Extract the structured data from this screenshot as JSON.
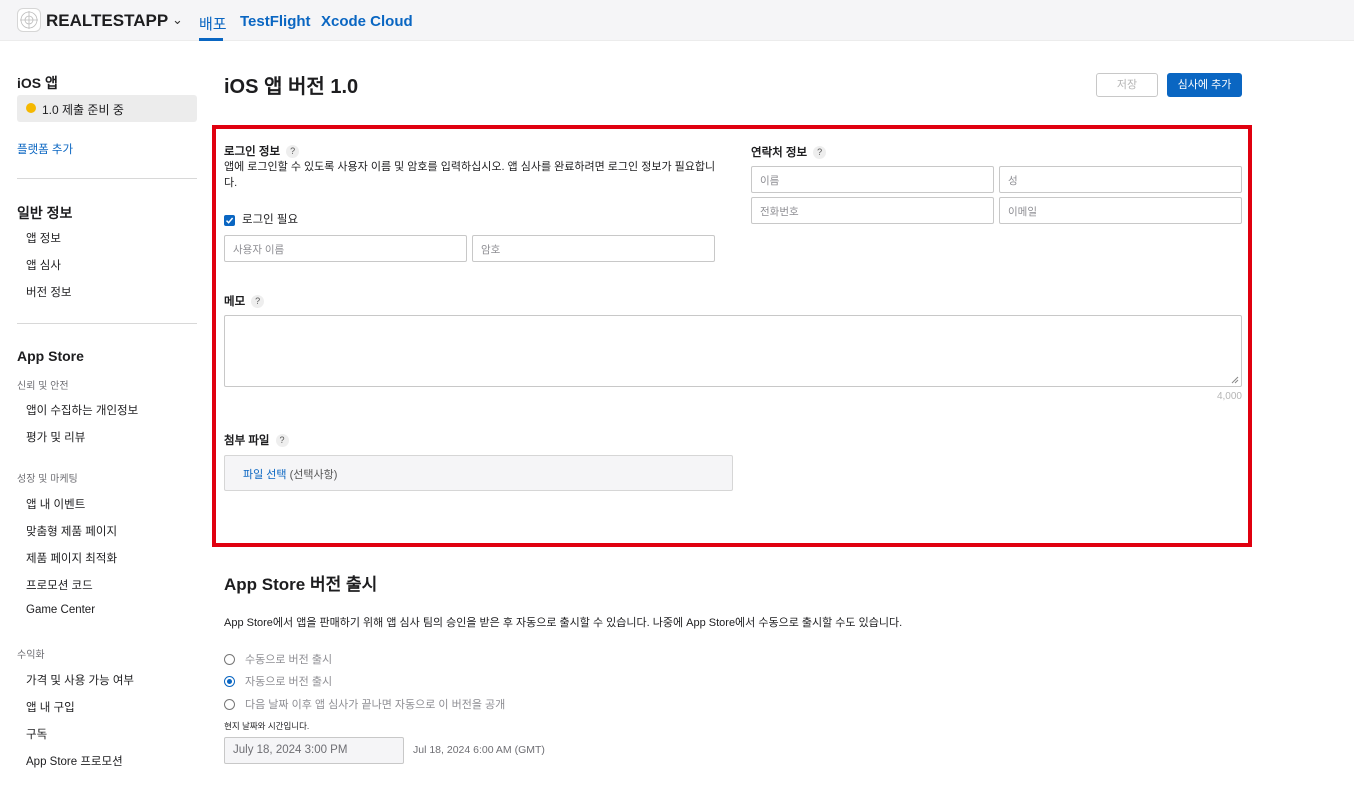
{
  "topbar": {
    "app_name": "REALTESTAPP",
    "tabs": [
      {
        "label": "배포",
        "active": true
      },
      {
        "label": "TestFlight",
        "active": false
      },
      {
        "label": "Xcode Cloud",
        "active": false
      }
    ]
  },
  "sidebar": {
    "ios_header": "iOS 앱",
    "status_label": "1.0 제출 준비 중",
    "add_platform": "플랫폼 추가",
    "general_header": "일반 정보",
    "general_items": [
      "앱 정보",
      "앱 심사",
      "버전 정보"
    ],
    "appstore_header": "App Store",
    "trust_sub": "신뢰 및 안전",
    "trust_items": [
      "앱이 수집하는 개인정보",
      "평가 및 리뷰"
    ],
    "growth_sub": "성장 및 마케팅",
    "growth_items": [
      "앱 내 이벤트",
      "맞춤형 제품 페이지",
      "제품 페이지 최적화",
      "프로모션 코드",
      "Game Center"
    ],
    "monetize_sub": "수익화",
    "monetize_items": [
      "가격 및 사용 가능 여부",
      "앱 내 구입",
      "구독",
      "App Store 프로모션"
    ]
  },
  "main": {
    "title": "iOS 앱 버전 1.0",
    "save_label": "저장",
    "add_review_label": "심사에 추가"
  },
  "review_info": {
    "login_label": "로그인 정보",
    "login_desc": "앱에 로그인할 수 있도록 사용자 이름 및 암호를 입력하십시오. 앱 심사를 완료하려면 로그인 정보가 필요합니다.",
    "login_required_label": "로그인 필요",
    "login_required_checked": true,
    "username_placeholder": "사용자 이름",
    "password_placeholder": "암호",
    "contact_label": "연락처 정보",
    "first_name_placeholder": "이름",
    "last_name_placeholder": "성",
    "phone_placeholder": "전화번호",
    "email_placeholder": "이메일",
    "notes_label": "메모",
    "notes_counter": "4,000",
    "attachment_label": "첨부 파일",
    "choose_file": "파일 선택",
    "optional": "(선택사항)",
    "help_glyph": "?"
  },
  "release": {
    "title": "App Store 버전 출시",
    "desc": "App Store에서 앱을 판매하기 위해 앱 심사 팀의 승인을 받은 후 자동으로 출시할 수 있습니다. 나중에 App Store에서 수동으로 출시할 수도 있습니다.",
    "options": [
      {
        "label": "수동으로 버전 출시",
        "selected": false
      },
      {
        "label": "자동으로 버전 출시",
        "selected": true
      },
      {
        "label": "다음 날짜 이후 앱 심사가 끝나면 자동으로 이 버전을 공개",
        "selected": false
      }
    ],
    "tz_note": "현지 날짜와 시간입니다.",
    "date_value": "July 18, 2024 3:00 PM",
    "gmt_value": "Jul 18, 2024 6:00 AM (GMT)"
  },
  "colors": {
    "accent": "#0a66c2",
    "highlight": "#e0000f",
    "status_dot": "#f5b800"
  }
}
